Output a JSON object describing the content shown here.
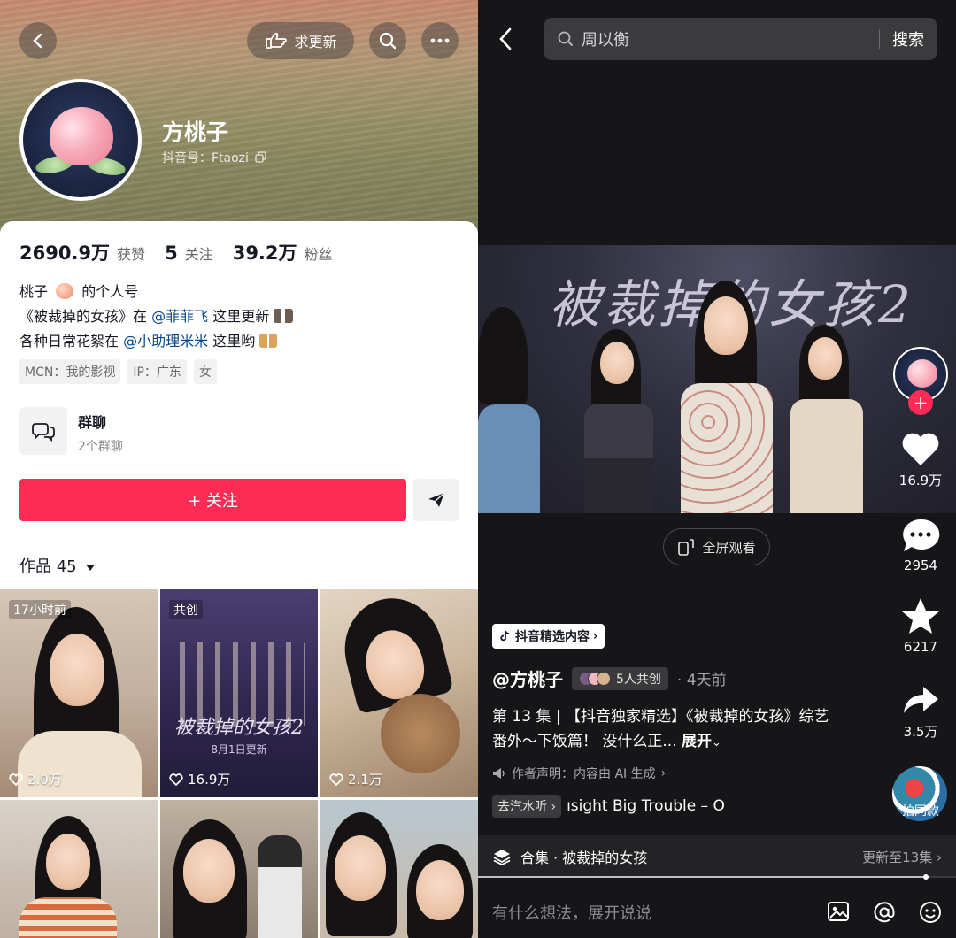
{
  "profile": {
    "follow_update_label": "求更新",
    "name": "方桃子",
    "douyin_id": "抖音号：Ftaozi",
    "stats": [
      {
        "value": "2690.9万",
        "label": "获赞"
      },
      {
        "value": "5",
        "label": "关注"
      },
      {
        "value": "39.2万",
        "label": "粉丝"
      }
    ],
    "bio": {
      "line1_a": "桃子",
      "line1_b": "的个人号",
      "line2_a": "《被裁掉的女孩》在",
      "line2_at": "@菲菲飞",
      "line2_b": "这里更新",
      "line3_a": "各种日常花絮在",
      "line3_at": "@小助理米米",
      "line3_b": "这里哟"
    },
    "tags": [
      "MCN：我的影视",
      "IP：广东",
      "女"
    ],
    "group": {
      "title": "群聊",
      "sub": "2个群聊"
    },
    "follow_button": "+ 关注",
    "works_label": "作品 45",
    "grid": [
      {
        "badge": "17小时前",
        "likes": "2.0万"
      },
      {
        "badge": "共创",
        "likes": "16.9万",
        "poster_title": "被裁掉的女孩2",
        "poster_sub": "— 8月1日更新 —"
      },
      {
        "badge": "",
        "likes": "2.1万"
      },
      {
        "badge": "",
        "likes": ""
      },
      {
        "badge": "",
        "likes": ""
      },
      {
        "badge": "",
        "likes": ""
      }
    ]
  },
  "video": {
    "search_query": "周以衡",
    "search_button": "搜索",
    "video_title": "被裁掉的女孩2",
    "fullscreen_label": "全屏观看",
    "like_count": "16.9万",
    "comment_count": "2954",
    "favorite_count": "6217",
    "share_count": "3.5万",
    "source_chip": "抖音精选内容",
    "author": "@方桃子",
    "cocreate": "5人共创",
    "time": "· 4天前",
    "desc_text": "第 13 集 | 【抖音独家精选】《被裁掉的女孩》综艺番外～下饭篇！ 没什么正...",
    "desc_expand": "展开",
    "declaration": "作者声明：内容由 AI 生成",
    "music_tag": "去汽水听",
    "music_title": "ısight  Big Trouble – O",
    "shoot_label": "拍同款",
    "collection_label": "合集 · 被裁掉的女孩",
    "collection_update": "更新至13集",
    "comment_placeholder": "有什么想法，展开说说"
  },
  "colors": {
    "accent": "#fe2c55",
    "link": "#04498d",
    "dark_bg": "#161618"
  }
}
